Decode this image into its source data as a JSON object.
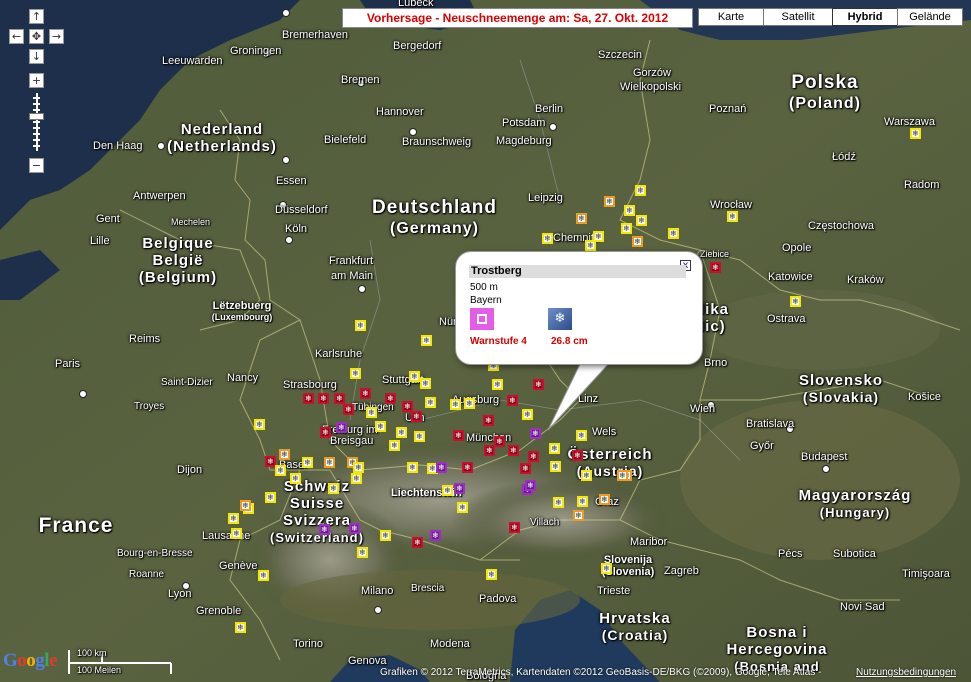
{
  "forecast_label": "Vorhersage - Neuschneemenge am: Sa, 27. Okt. 2012",
  "map_types": [
    {
      "label": "Karte",
      "active": false
    },
    {
      "label": "Satellit",
      "active": false
    },
    {
      "label": "Hybrid",
      "active": true
    },
    {
      "label": "Gelände",
      "active": false
    }
  ],
  "nav": {
    "up": "↑",
    "down": "↓",
    "left": "←",
    "right": "→",
    "center": "✥",
    "zoom_in": "+",
    "zoom_out": "−"
  },
  "countries": [
    {
      "id": "netherlands",
      "lines": [
        "Nederland",
        "(Netherlands)"
      ]
    },
    {
      "id": "germany",
      "lines": [
        "Deutschland",
        "(Germany)"
      ]
    },
    {
      "id": "belgium",
      "lines": [
        "Belgique",
        "België",
        "(Belgium)"
      ]
    },
    {
      "id": "luxembourg",
      "lines": [
        "Lëtzebuerg",
        "(Luxembourg)"
      ]
    },
    {
      "id": "poland",
      "lines": [
        "Polska",
        "(Poland)"
      ]
    },
    {
      "id": "slovakia",
      "lines": [
        "Slovensko",
        "(Slovakia)"
      ]
    },
    {
      "id": "austria",
      "lines": [
        "Österreich",
        "(Austria)"
      ]
    },
    {
      "id": "hungary",
      "lines": [
        "Magyarország",
        "(Hungary)"
      ]
    },
    {
      "id": "switzerland",
      "lines": [
        "Schweiz",
        "Suisse",
        "Svizzera",
        "(Switzerland)"
      ]
    },
    {
      "id": "france",
      "lines": [
        "France"
      ]
    },
    {
      "id": "croatia",
      "lines": [
        "Hrvatska",
        "(Croatia)"
      ]
    },
    {
      "id": "bosnia",
      "lines": [
        "Bosna i",
        "Hercegovina",
        "(Bosnia and"
      ]
    },
    {
      "id": "slovenia",
      "lines": [
        "Slovenija",
        "(Slovenia)"
      ]
    },
    {
      "id": "liechtenstein",
      "lines": [
        "Liechtenstein"
      ]
    },
    {
      "id": "czech",
      "lines": [
        "lika",
        "lic)"
      ]
    }
  ],
  "cities": [
    "Lübeck",
    "Bremerhaven",
    "Szczecin",
    "Groningen",
    "Bergedorf",
    "Leeuwarden",
    "Gorzów",
    "Wielkopolski",
    "Bremen",
    "Hannover",
    "Potsdam",
    "Berlin",
    "Poznań",
    "Den Haag",
    "Bielefeld",
    "Braunschweig",
    "Magdeburg",
    "Warszawa",
    "Łódź",
    "Essen",
    "Radom",
    "Antwerpen",
    "Düsseldorf",
    "Leipzig",
    "Wrocław",
    "Częstochowa",
    "Gent",
    "Mechelen",
    "Chemnitz",
    "Lille",
    "Köln",
    "Opole",
    "Ziebice",
    "Katowice",
    "Kraków",
    "Frankfurt",
    "am Main",
    "Ostrava",
    "Reims",
    "Nürnberg",
    "Karlsruhe",
    "Brno",
    "Paris",
    "Nancy",
    "Saint-Dizier",
    "Strasbourg",
    "Stuttgart",
    "Troyes",
    "Tübingen",
    "Augsburg",
    "Ulm",
    "Wien",
    "Bratislava",
    "Freiburg im",
    "Breisgau",
    "München",
    "Linz",
    "Wels",
    "Győr",
    "Košice",
    "Dijon",
    "Basel",
    "Budapest",
    "Graz",
    "Lausanne",
    "Villach",
    "Bourg-en-Bresse",
    "Genève",
    "Maribor",
    "Pécs",
    "Roanne",
    "Zagreb",
    "Subotica",
    "Lyon",
    "Milano",
    "Brescia",
    "Padova",
    "Trieste",
    "Novi Sad",
    "Timişoara",
    "Grenoble",
    "Torino",
    "Modena",
    "Genova",
    "Bologna"
  ],
  "info_window": {
    "title": "Trostberg",
    "elevation": "500 m",
    "region": "Bayern",
    "warning": "Warnstufe 4",
    "snow_amount": "26.8  cm",
    "close": "x",
    "snow_icon": "❄"
  },
  "google_logo": "Google",
  "scale": {
    "km": "100 km",
    "miles": "100 Meilen"
  },
  "copyright": "Grafiken © 2012 TerraMetrics, Kartendaten ©2012 GeoBasis-DE/BKG (©2009), Google, Tele Atlas -",
  "terms": "Nutzungsbedingungen",
  "marker_symbol": "❄",
  "marker_levels": {
    "y": "#f5e800",
    "o": "#f09a20",
    "r": "#c8102e",
    "p": "#9b30c0"
  },
  "markers": [
    {
      "level": "y"
    },
    {
      "level": "o"
    },
    {
      "level": "y"
    },
    {
      "level": "o"
    },
    {
      "level": "y"
    },
    {
      "level": "y"
    },
    {
      "level": "y"
    },
    {
      "level": "y"
    },
    {
      "level": "y"
    },
    {
      "level": "y"
    },
    {
      "level": "r"
    },
    {
      "level": "o"
    },
    {
      "level": "y"
    },
    {
      "level": "y"
    },
    {
      "level": "y"
    },
    {
      "level": "y"
    },
    {
      "level": "y"
    },
    {
      "level": "r"
    },
    {
      "level": "r"
    },
    {
      "level": "r"
    },
    {
      "level": "r"
    },
    {
      "level": "y"
    },
    {
      "level": "r"
    },
    {
      "level": "r"
    },
    {
      "level": "y"
    },
    {
      "level": "y"
    },
    {
      "level": "r"
    },
    {
      "level": "r"
    },
    {
      "level": "r"
    },
    {
      "level": "r"
    },
    {
      "level": "y"
    },
    {
      "level": "y"
    },
    {
      "level": "r"
    },
    {
      "level": "r"
    },
    {
      "level": "r"
    },
    {
      "level": "y"
    },
    {
      "level": "y"
    },
    {
      "level": "p"
    },
    {
      "level": "r"
    },
    {
      "level": "r"
    },
    {
      "level": "y"
    },
    {
      "level": "r"
    },
    {
      "level": "y"
    },
    {
      "level": "y"
    },
    {
      "level": "y"
    },
    {
      "level": "r"
    },
    {
      "level": "y"
    },
    {
      "level": "y"
    },
    {
      "level": "y"
    },
    {
      "level": "y"
    },
    {
      "level": "y"
    },
    {
      "level": "p"
    },
    {
      "level": "y"
    },
    {
      "level": "y"
    },
    {
      "level": "r"
    },
    {
      "level": "p"
    },
    {
      "level": "r"
    },
    {
      "level": "p"
    },
    {
      "level": "p"
    },
    {
      "level": "r"
    },
    {
      "level": "y"
    },
    {
      "level": "y"
    },
    {
      "level": "y"
    },
    {
      "level": "y"
    },
    {
      "level": "o"
    },
    {
      "level": "y"
    },
    {
      "level": "o"
    },
    {
      "level": "y"
    },
    {
      "level": "o"
    },
    {
      "level": "y"
    },
    {
      "level": "o"
    },
    {
      "level": "p"
    },
    {
      "level": "p"
    },
    {
      "level": "p"
    },
    {
      "level": "r"
    },
    {
      "level": "p"
    },
    {
      "level": "y"
    },
    {
      "level": "y"
    },
    {
      "level": "y"
    },
    {
      "level": "r"
    },
    {
      "level": "y"
    },
    {
      "level": "y"
    },
    {
      "level": "y"
    },
    {
      "level": "y"
    },
    {
      "level": "y"
    },
    {
      "level": "y"
    },
    {
      "level": "y"
    },
    {
      "level": "y"
    },
    {
      "level": "o"
    },
    {
      "level": "o"
    },
    {
      "level": "y"
    },
    {
      "level": "y"
    },
    {
      "level": "y"
    },
    {
      "level": "o"
    },
    {
      "level": "y"
    },
    {
      "level": "y"
    },
    {
      "level": "o"
    },
    {
      "level": "r"
    },
    {
      "level": "y"
    },
    {
      "level": "y"
    }
  ]
}
